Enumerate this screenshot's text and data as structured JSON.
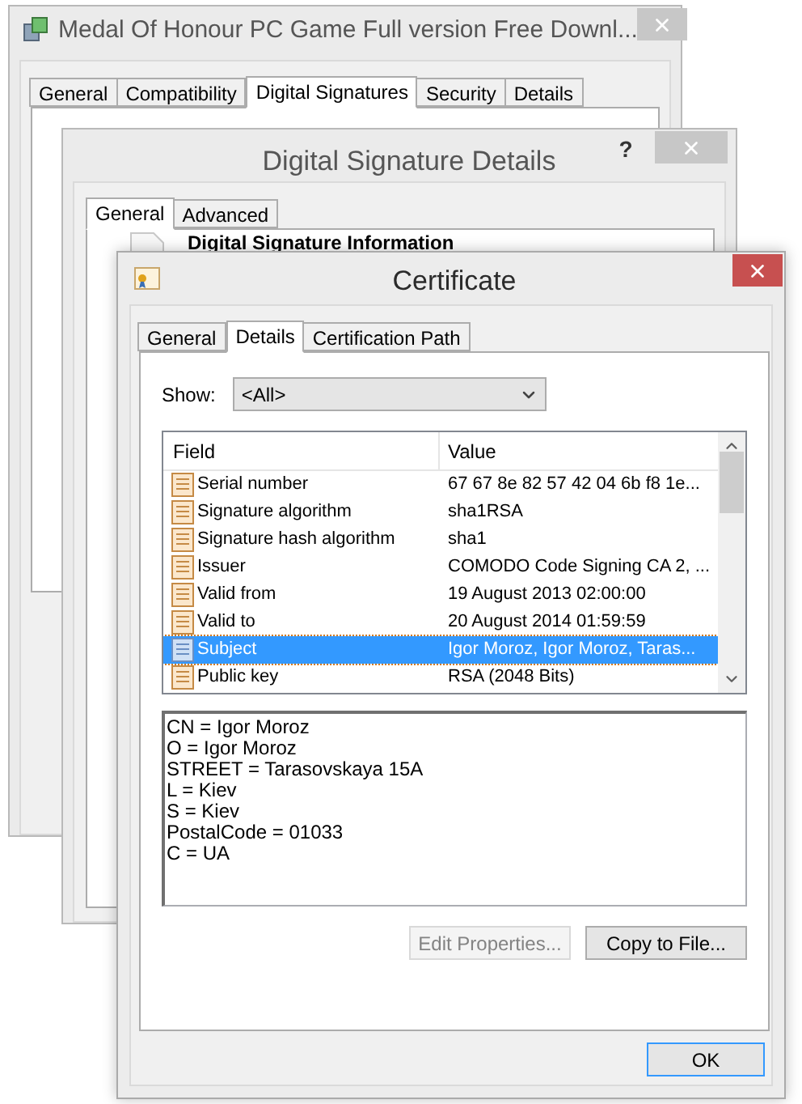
{
  "properties_window": {
    "title": "Medal Of Honour PC Game Full version Free Downl...",
    "active": false,
    "tabs": [
      {
        "label": "General",
        "selected": false
      },
      {
        "label": "Compatibility",
        "selected": false
      },
      {
        "label": "Digital Signatures",
        "selected": true
      },
      {
        "label": "Security",
        "selected": false
      },
      {
        "label": "Details",
        "selected": false
      }
    ]
  },
  "signature_window": {
    "title": "Digital Signature Details",
    "help": "?",
    "active": false,
    "tabs": [
      {
        "label": "General",
        "selected": true
      },
      {
        "label": "Advanced",
        "selected": false
      }
    ],
    "heading": "Digital Signature Information"
  },
  "certificate_window": {
    "title": "Certificate",
    "active": true,
    "tabs": [
      {
        "label": "General",
        "selected": false
      },
      {
        "label": "Details",
        "selected": true
      },
      {
        "label": "Certification Path",
        "selected": false
      }
    ],
    "show_label": "Show:",
    "show_value": "<All>",
    "columns": [
      "Field",
      "Value"
    ],
    "rows": [
      {
        "field": "Serial number",
        "value": "67 67 8e 82 57 42 04 6b f8 1e...",
        "selected": false
      },
      {
        "field": "Signature algorithm",
        "value": "sha1RSA",
        "selected": false
      },
      {
        "field": "Signature hash algorithm",
        "value": "sha1",
        "selected": false
      },
      {
        "field": "Issuer",
        "value": "COMODO Code Signing CA 2, ...",
        "selected": false
      },
      {
        "field": "Valid from",
        "value": "19 August 2013 02:00:00",
        "selected": false
      },
      {
        "field": "Valid to",
        "value": "20 August 2014 01:59:59",
        "selected": false
      },
      {
        "field": "Subject",
        "value": "Igor Moroz, Igor Moroz, Taras...",
        "selected": true
      },
      {
        "field": "Public key",
        "value": "RSA (2048 Bits)",
        "selected": false
      }
    ],
    "detail_lines": [
      "CN = Igor Moroz",
      "O = Igor Moroz",
      "STREET = Tarasovskaya 15A",
      "L = Kiev",
      "S = Kiev",
      "PostalCode = 01033",
      "C = UA"
    ],
    "buttons": [
      {
        "label": "Edit Properties...",
        "disabled": true
      },
      {
        "label": "Copy to File...",
        "disabled": false
      }
    ],
    "ok_button": "OK"
  }
}
